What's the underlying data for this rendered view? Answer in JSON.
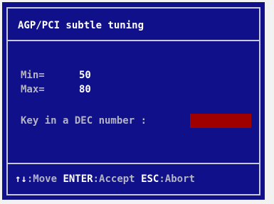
{
  "dialog": {
    "title": "AGP/PCI subtle tuning",
    "min_label": "Min=",
    "min_value": "50",
    "max_label": "Max=",
    "max_value": "80",
    "prompt": "Key in a DEC number :",
    "input_value": "",
    "footer": {
      "move_key": "↑↓",
      "move_label": ":Move",
      "enter_key": "ENTER",
      "enter_label": ":Accept",
      "esc_key": "ESC",
      "esc_label": ":Abort"
    }
  },
  "colors": {
    "dialog_background": "#10108a",
    "frame": "#c8c8d8",
    "input_background": "#a00000",
    "text": "#ffffff"
  }
}
